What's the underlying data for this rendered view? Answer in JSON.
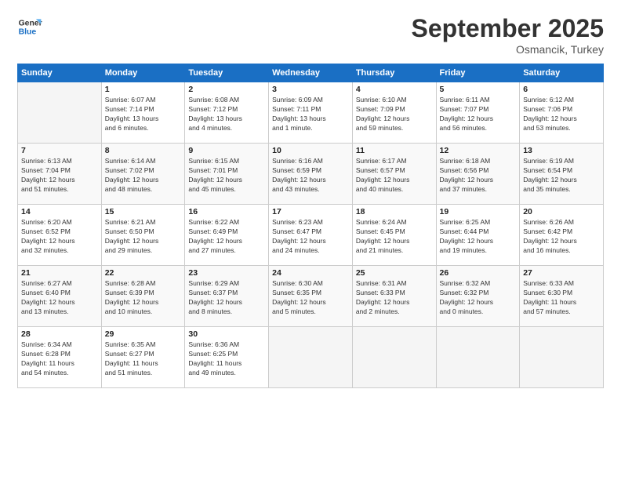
{
  "header": {
    "logo_line1": "General",
    "logo_line2": "Blue",
    "month": "September 2025",
    "location": "Osmancik, Turkey"
  },
  "weekdays": [
    "Sunday",
    "Monday",
    "Tuesday",
    "Wednesday",
    "Thursday",
    "Friday",
    "Saturday"
  ],
  "weeks": [
    [
      {
        "day": "",
        "info": ""
      },
      {
        "day": "1",
        "info": "Sunrise: 6:07 AM\nSunset: 7:14 PM\nDaylight: 13 hours\nand 6 minutes."
      },
      {
        "day": "2",
        "info": "Sunrise: 6:08 AM\nSunset: 7:12 PM\nDaylight: 13 hours\nand 4 minutes."
      },
      {
        "day": "3",
        "info": "Sunrise: 6:09 AM\nSunset: 7:11 PM\nDaylight: 13 hours\nand 1 minute."
      },
      {
        "day": "4",
        "info": "Sunrise: 6:10 AM\nSunset: 7:09 PM\nDaylight: 12 hours\nand 59 minutes."
      },
      {
        "day": "5",
        "info": "Sunrise: 6:11 AM\nSunset: 7:07 PM\nDaylight: 12 hours\nand 56 minutes."
      },
      {
        "day": "6",
        "info": "Sunrise: 6:12 AM\nSunset: 7:06 PM\nDaylight: 12 hours\nand 53 minutes."
      }
    ],
    [
      {
        "day": "7",
        "info": "Sunrise: 6:13 AM\nSunset: 7:04 PM\nDaylight: 12 hours\nand 51 minutes."
      },
      {
        "day": "8",
        "info": "Sunrise: 6:14 AM\nSunset: 7:02 PM\nDaylight: 12 hours\nand 48 minutes."
      },
      {
        "day": "9",
        "info": "Sunrise: 6:15 AM\nSunset: 7:01 PM\nDaylight: 12 hours\nand 45 minutes."
      },
      {
        "day": "10",
        "info": "Sunrise: 6:16 AM\nSunset: 6:59 PM\nDaylight: 12 hours\nand 43 minutes."
      },
      {
        "day": "11",
        "info": "Sunrise: 6:17 AM\nSunset: 6:57 PM\nDaylight: 12 hours\nand 40 minutes."
      },
      {
        "day": "12",
        "info": "Sunrise: 6:18 AM\nSunset: 6:56 PM\nDaylight: 12 hours\nand 37 minutes."
      },
      {
        "day": "13",
        "info": "Sunrise: 6:19 AM\nSunset: 6:54 PM\nDaylight: 12 hours\nand 35 minutes."
      }
    ],
    [
      {
        "day": "14",
        "info": "Sunrise: 6:20 AM\nSunset: 6:52 PM\nDaylight: 12 hours\nand 32 minutes."
      },
      {
        "day": "15",
        "info": "Sunrise: 6:21 AM\nSunset: 6:50 PM\nDaylight: 12 hours\nand 29 minutes."
      },
      {
        "day": "16",
        "info": "Sunrise: 6:22 AM\nSunset: 6:49 PM\nDaylight: 12 hours\nand 27 minutes."
      },
      {
        "day": "17",
        "info": "Sunrise: 6:23 AM\nSunset: 6:47 PM\nDaylight: 12 hours\nand 24 minutes."
      },
      {
        "day": "18",
        "info": "Sunrise: 6:24 AM\nSunset: 6:45 PM\nDaylight: 12 hours\nand 21 minutes."
      },
      {
        "day": "19",
        "info": "Sunrise: 6:25 AM\nSunset: 6:44 PM\nDaylight: 12 hours\nand 19 minutes."
      },
      {
        "day": "20",
        "info": "Sunrise: 6:26 AM\nSunset: 6:42 PM\nDaylight: 12 hours\nand 16 minutes."
      }
    ],
    [
      {
        "day": "21",
        "info": "Sunrise: 6:27 AM\nSunset: 6:40 PM\nDaylight: 12 hours\nand 13 minutes."
      },
      {
        "day": "22",
        "info": "Sunrise: 6:28 AM\nSunset: 6:39 PM\nDaylight: 12 hours\nand 10 minutes."
      },
      {
        "day": "23",
        "info": "Sunrise: 6:29 AM\nSunset: 6:37 PM\nDaylight: 12 hours\nand 8 minutes."
      },
      {
        "day": "24",
        "info": "Sunrise: 6:30 AM\nSunset: 6:35 PM\nDaylight: 12 hours\nand 5 minutes."
      },
      {
        "day": "25",
        "info": "Sunrise: 6:31 AM\nSunset: 6:33 PM\nDaylight: 12 hours\nand 2 minutes."
      },
      {
        "day": "26",
        "info": "Sunrise: 6:32 AM\nSunset: 6:32 PM\nDaylight: 12 hours\nand 0 minutes."
      },
      {
        "day": "27",
        "info": "Sunrise: 6:33 AM\nSunset: 6:30 PM\nDaylight: 11 hours\nand 57 minutes."
      }
    ],
    [
      {
        "day": "28",
        "info": "Sunrise: 6:34 AM\nSunset: 6:28 PM\nDaylight: 11 hours\nand 54 minutes."
      },
      {
        "day": "29",
        "info": "Sunrise: 6:35 AM\nSunset: 6:27 PM\nDaylight: 11 hours\nand 51 minutes."
      },
      {
        "day": "30",
        "info": "Sunrise: 6:36 AM\nSunset: 6:25 PM\nDaylight: 11 hours\nand 49 minutes."
      },
      {
        "day": "",
        "info": ""
      },
      {
        "day": "",
        "info": ""
      },
      {
        "day": "",
        "info": ""
      },
      {
        "day": "",
        "info": ""
      }
    ]
  ]
}
